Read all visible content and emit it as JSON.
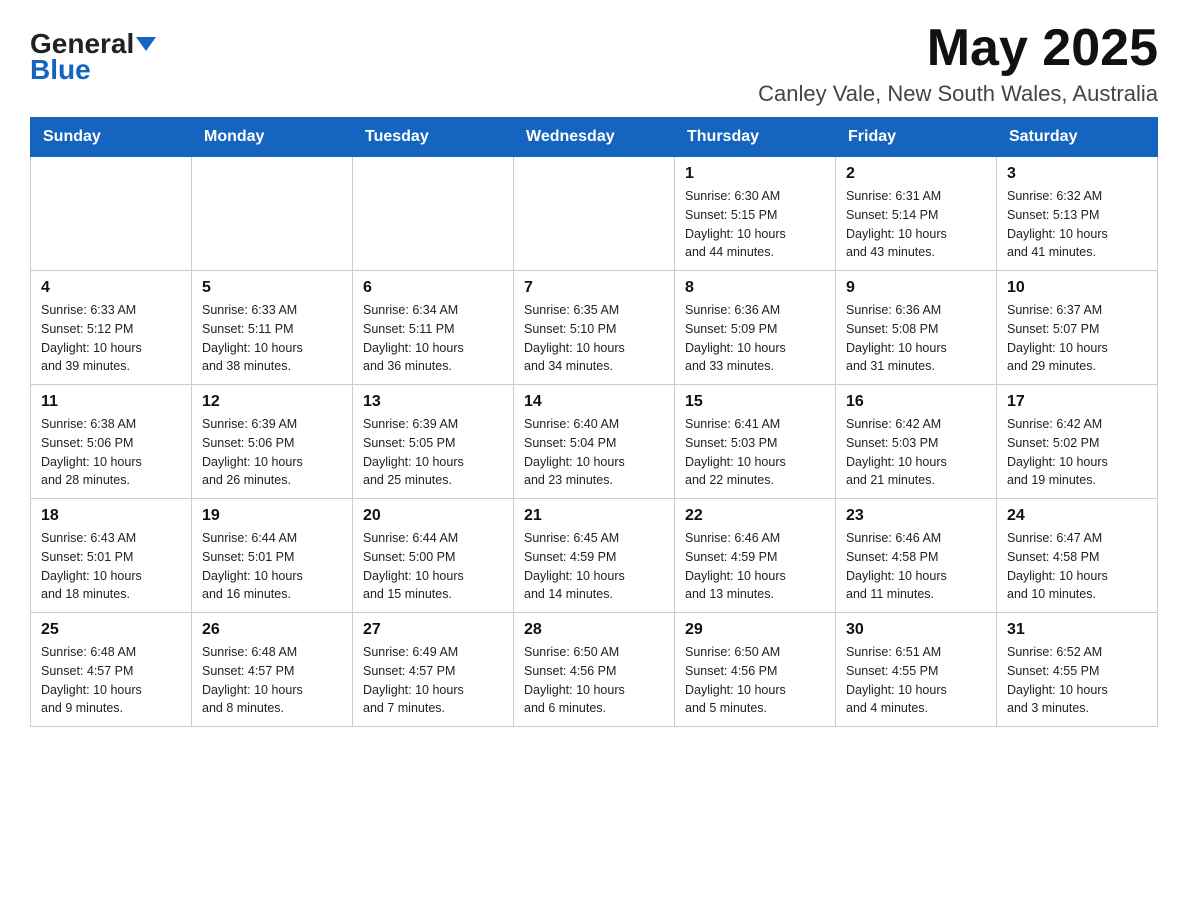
{
  "header": {
    "logo_general": "General",
    "logo_blue": "Blue",
    "month_title": "May 2025",
    "location": "Canley Vale, New South Wales, Australia"
  },
  "days_of_week": [
    "Sunday",
    "Monday",
    "Tuesday",
    "Wednesday",
    "Thursday",
    "Friday",
    "Saturday"
  ],
  "weeks": [
    [
      {
        "day": "",
        "info": ""
      },
      {
        "day": "",
        "info": ""
      },
      {
        "day": "",
        "info": ""
      },
      {
        "day": "",
        "info": ""
      },
      {
        "day": "1",
        "info": "Sunrise: 6:30 AM\nSunset: 5:15 PM\nDaylight: 10 hours\nand 44 minutes."
      },
      {
        "day": "2",
        "info": "Sunrise: 6:31 AM\nSunset: 5:14 PM\nDaylight: 10 hours\nand 43 minutes."
      },
      {
        "day": "3",
        "info": "Sunrise: 6:32 AM\nSunset: 5:13 PM\nDaylight: 10 hours\nand 41 minutes."
      }
    ],
    [
      {
        "day": "4",
        "info": "Sunrise: 6:33 AM\nSunset: 5:12 PM\nDaylight: 10 hours\nand 39 minutes."
      },
      {
        "day": "5",
        "info": "Sunrise: 6:33 AM\nSunset: 5:11 PM\nDaylight: 10 hours\nand 38 minutes."
      },
      {
        "day": "6",
        "info": "Sunrise: 6:34 AM\nSunset: 5:11 PM\nDaylight: 10 hours\nand 36 minutes."
      },
      {
        "day": "7",
        "info": "Sunrise: 6:35 AM\nSunset: 5:10 PM\nDaylight: 10 hours\nand 34 minutes."
      },
      {
        "day": "8",
        "info": "Sunrise: 6:36 AM\nSunset: 5:09 PM\nDaylight: 10 hours\nand 33 minutes."
      },
      {
        "day": "9",
        "info": "Sunrise: 6:36 AM\nSunset: 5:08 PM\nDaylight: 10 hours\nand 31 minutes."
      },
      {
        "day": "10",
        "info": "Sunrise: 6:37 AM\nSunset: 5:07 PM\nDaylight: 10 hours\nand 29 minutes."
      }
    ],
    [
      {
        "day": "11",
        "info": "Sunrise: 6:38 AM\nSunset: 5:06 PM\nDaylight: 10 hours\nand 28 minutes."
      },
      {
        "day": "12",
        "info": "Sunrise: 6:39 AM\nSunset: 5:06 PM\nDaylight: 10 hours\nand 26 minutes."
      },
      {
        "day": "13",
        "info": "Sunrise: 6:39 AM\nSunset: 5:05 PM\nDaylight: 10 hours\nand 25 minutes."
      },
      {
        "day": "14",
        "info": "Sunrise: 6:40 AM\nSunset: 5:04 PM\nDaylight: 10 hours\nand 23 minutes."
      },
      {
        "day": "15",
        "info": "Sunrise: 6:41 AM\nSunset: 5:03 PM\nDaylight: 10 hours\nand 22 minutes."
      },
      {
        "day": "16",
        "info": "Sunrise: 6:42 AM\nSunset: 5:03 PM\nDaylight: 10 hours\nand 21 minutes."
      },
      {
        "day": "17",
        "info": "Sunrise: 6:42 AM\nSunset: 5:02 PM\nDaylight: 10 hours\nand 19 minutes."
      }
    ],
    [
      {
        "day": "18",
        "info": "Sunrise: 6:43 AM\nSunset: 5:01 PM\nDaylight: 10 hours\nand 18 minutes."
      },
      {
        "day": "19",
        "info": "Sunrise: 6:44 AM\nSunset: 5:01 PM\nDaylight: 10 hours\nand 16 minutes."
      },
      {
        "day": "20",
        "info": "Sunrise: 6:44 AM\nSunset: 5:00 PM\nDaylight: 10 hours\nand 15 minutes."
      },
      {
        "day": "21",
        "info": "Sunrise: 6:45 AM\nSunset: 4:59 PM\nDaylight: 10 hours\nand 14 minutes."
      },
      {
        "day": "22",
        "info": "Sunrise: 6:46 AM\nSunset: 4:59 PM\nDaylight: 10 hours\nand 13 minutes."
      },
      {
        "day": "23",
        "info": "Sunrise: 6:46 AM\nSunset: 4:58 PM\nDaylight: 10 hours\nand 11 minutes."
      },
      {
        "day": "24",
        "info": "Sunrise: 6:47 AM\nSunset: 4:58 PM\nDaylight: 10 hours\nand 10 minutes."
      }
    ],
    [
      {
        "day": "25",
        "info": "Sunrise: 6:48 AM\nSunset: 4:57 PM\nDaylight: 10 hours\nand 9 minutes."
      },
      {
        "day": "26",
        "info": "Sunrise: 6:48 AM\nSunset: 4:57 PM\nDaylight: 10 hours\nand 8 minutes."
      },
      {
        "day": "27",
        "info": "Sunrise: 6:49 AM\nSunset: 4:57 PM\nDaylight: 10 hours\nand 7 minutes."
      },
      {
        "day": "28",
        "info": "Sunrise: 6:50 AM\nSunset: 4:56 PM\nDaylight: 10 hours\nand 6 minutes."
      },
      {
        "day": "29",
        "info": "Sunrise: 6:50 AM\nSunset: 4:56 PM\nDaylight: 10 hours\nand 5 minutes."
      },
      {
        "day": "30",
        "info": "Sunrise: 6:51 AM\nSunset: 4:55 PM\nDaylight: 10 hours\nand 4 minutes."
      },
      {
        "day": "31",
        "info": "Sunrise: 6:52 AM\nSunset: 4:55 PM\nDaylight: 10 hours\nand 3 minutes."
      }
    ]
  ]
}
